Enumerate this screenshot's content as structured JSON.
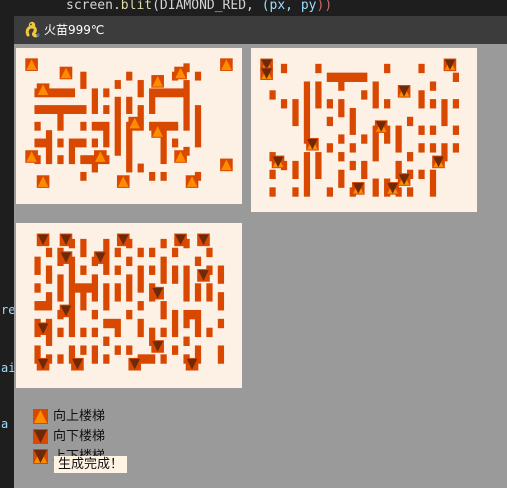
{
  "ide": {
    "code_line_parts": [
      "screen.",
      "blit",
      "(DIAMOND_RED, ",
      "(px, py",
      ")",
      ")"
    ],
    "gutter_fragments": [
      "re",
      "ai",
      "a"
    ]
  },
  "window": {
    "title": "火苗999℃",
    "icon": "python-snake-icon"
  },
  "colors": {
    "background": "#9a9a9a",
    "maze_floor": "#fdf0e4",
    "maze_wall": "#d84800",
    "stairs_up": "#ff8c00",
    "stairs_down": "#6e2a08",
    "titlebar": "#3c3c3c"
  },
  "legend": [
    {
      "type": "up",
      "label": "向上楼梯"
    },
    {
      "type": "down",
      "label": "向下楼梯"
    },
    {
      "type": "both",
      "label": "上下楼梯"
    }
  ],
  "status": "生成完成！",
  "mazes": [
    {
      "name": "maze-floor-1",
      "stairs": "up",
      "grid": [
        "XXXXXXXXXXXXXXXXXXXXXXXXXXXXXXXXXXXXX",
        "X...........................X.......X",
        "X.........X.......X.......X...X.....X",
        "X.........X.....X...X.......X.......X",
        "X.XXXXXXX...X.X.....X.XXXXXXX.......X",
        "X...........X...X.X...X.....X.......X",
        "X.XXXXXXXXX.X.X.X.X.X.X.....X.X.....X",
        "X.....X.........X...X.......X.X.....X",
        "X.X...X...X.XXX.X.XXX.XXXXX.X.X.....X",
        "X...X.........X.X.X.....X.....X.....X",
        "X.XXX.X.XXX.X.X.X.X.....X.X...X.....X",
        "X...X...X.......X.X.....X...X.......X",
        "X.X.X.X.X.XXXXX...X.....X...........X",
        "X...........X.....X.X...............X",
        "X.........X...........X.X.....X.....X",
        "X...................................X",
        "XXXXXXXXXXXXXXXXXXXXXXXXXXXXXXXXXXXXX"
      ],
      "markers": [
        [
          1,
          1
        ],
        [
          1,
          35
        ],
        [
          2,
          7
        ],
        [
          2,
          27
        ],
        [
          3,
          23
        ],
        [
          4,
          3
        ],
        [
          8,
          19
        ],
        [
          9,
          23
        ],
        [
          12,
          1
        ],
        [
          12,
          13
        ],
        [
          12,
          27
        ],
        [
          13,
          35
        ],
        [
          15,
          3
        ],
        [
          15,
          17
        ],
        [
          15,
          29
        ]
      ]
    },
    {
      "name": "maze-floor-2",
      "stairs": "both",
      "grid": [
        "XXXXXXXXXXXXXXXXXXXXXXXXXXXXXXXXXXXXX",
        "X...X.....X...........X.....X.......X",
        "X...........XXXXXXX...............X.X",
        "X.......X.X...X.....X.........X.....X",
        "X.X.....X.X.......X.X.......X.......X",
        "X...X.X.X.X.X.X.....X.X.....X.X.X.X.X",
        "X.....X.X.....X.X...............X...X",
        "X.....X.X...X...X.........X.....X...X",
        "X.......X.......X...X.X.X...X.X...X.X",
        "X.......X.....X...X.X.X.X...........X",
        "X...........X...X...X...X...X.X.X.X.X",
        "X.X.....X.X...X.....X.....X.....X...X",
        "X...X.X.X.X.....X.X.....X...........X",
        "X.X...X.X.X...X...X.....X.X.X.X.....X",
        "X.......X.....X.....X.X.......X.....X",
        "X.X...X.X...X...X...X.X.X.X...X.....X",
        "XXXXXXXXXXXXXXXXXXXXXXXXXXXXXXXXXXXXX"
      ],
      "markers": [
        [
          1,
          1
        ],
        [
          1,
          33
        ],
        [
          2,
          1
        ],
        [
          4,
          25
        ],
        [
          8,
          21
        ],
        [
          10,
          9
        ],
        [
          12,
          3
        ],
        [
          12,
          31
        ],
        [
          14,
          25
        ],
        [
          15,
          17
        ],
        [
          15,
          23
        ]
      ]
    },
    {
      "name": "maze-floor-3",
      "stairs": "down",
      "grid": [
        "XXXXXXXXXXXXXXXXXXXXXXXXXXXXXXXXXXXXX",
        "X.......X.X...X...X.....X...X.......X",
        "X...X.X...X...X.X...X.X...X.....X...X",
        "X.X...X.X...X.X...X.....X.....X.....X",
        "X.X.X...X.X...X.X...X.X.X.X.X...X.X.X",
        "X...X.X.X...X.....X.X...X.X.X.....X.X",
        "X.X...X.XXXXX.X.X.X.X.X.....X.X.X...X",
        "X...X.X.X.X.X.X.X.X...X.....X.X.X.X.X",
        "X.XXX...X.X...X.....X...X.........X.X",
        "X.....X.X...X.....X.....X.X.XXX.....X",
        "X.X.X...X.....XXX...X.....X.X.X...X.X",
        "X.X.X.X.X.X.X...X...X.X.X.X...X.X...X",
        "X...X.........X.......X.....X.......X",
        "X.X.....X.X.X...X.X.......X...X...X.X",
        "X.X.X.X.X...X.X.....XXX.X...X.X...X.X",
        "X...................................X",
        "XXXXXXXXXXXXXXXXXXXXXXXXXXXXXXXXXXXXX"
      ],
      "markers": [
        [
          1,
          3
        ],
        [
          1,
          7
        ],
        [
          1,
          17
        ],
        [
          1,
          27
        ],
        [
          1,
          31
        ],
        [
          3,
          7
        ],
        [
          3,
          13
        ],
        [
          5,
          31
        ],
        [
          7,
          23
        ],
        [
          9,
          7
        ],
        [
          11,
          3
        ],
        [
          13,
          23
        ],
        [
          15,
          3
        ],
        [
          15,
          9
        ],
        [
          15,
          19
        ],
        [
          15,
          29
        ]
      ]
    }
  ]
}
